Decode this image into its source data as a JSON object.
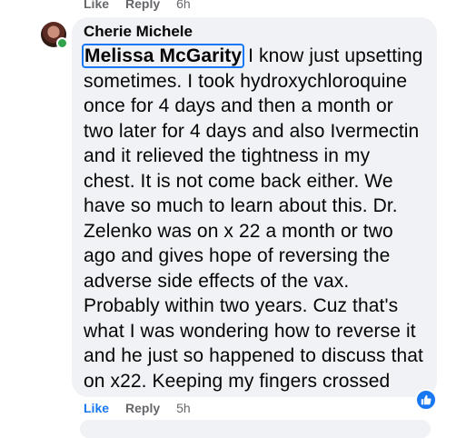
{
  "previous_comment_actions": {
    "like_label": "Like",
    "reply_label": "Reply",
    "timestamp": "6h"
  },
  "comment": {
    "author": "Cherie Michele",
    "mention": "Melissa McGarity",
    "text": " I know just upsetting sometimes. I took hydroxychloroquine once for 4 days and then a month or two later for 4 days and also Ivermectin and it relieved the tightness in my chest. It is not come back either. We have so much to learn about this. Dr. Zelenko was on x 22 a month or two ago and gives hope of reversing the adverse side effects of the vax. Probably within two years. Cuz that's what I was wondering how to reverse it and he just so happened to discuss that on x22. Keeping my fingers crossed",
    "reaction_icon": "thumbs-up-icon",
    "presence_color": "#31a24c"
  },
  "comment_actions": {
    "like_label": "Like",
    "reply_label": "Reply",
    "timestamp": "5h"
  },
  "colors": {
    "bubble_bg": "#f0f2f5",
    "link_blue": "#1877f2",
    "meta_gray": "#65676b"
  }
}
